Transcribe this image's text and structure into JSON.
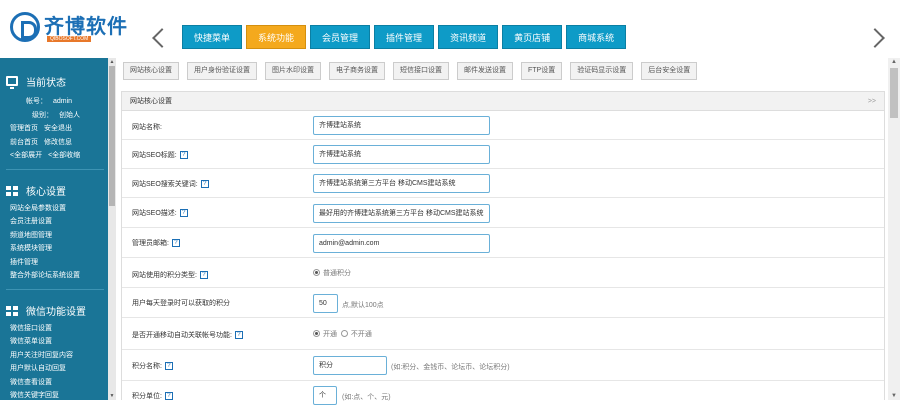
{
  "brand": {
    "name": "齐博软件",
    "tagline": "QIBOSOFT.COM"
  },
  "topnav": {
    "tabs": [
      {
        "label": "快捷菜单",
        "active": false
      },
      {
        "label": "系统功能",
        "active": true
      },
      {
        "label": "会员管理",
        "active": false
      },
      {
        "label": "插件管理",
        "active": false
      },
      {
        "label": "资讯频道",
        "active": false
      },
      {
        "label": "黄页店铺",
        "active": false
      },
      {
        "label": "商城系统",
        "active": false
      }
    ]
  },
  "sidebar": {
    "status": {
      "title": "当前状态",
      "rows": [
        {
          "k": "帐号：",
          "v": "admin"
        },
        {
          "k": "级别：",
          "v": "创始人"
        }
      ],
      "links": [
        {
          "a": "管理首页",
          "b": "安全退出"
        },
        {
          "a": "前台首页",
          "b": "修改信息"
        },
        {
          "a": "<全部展开",
          "b": "<全部收缩"
        }
      ]
    },
    "core": {
      "title": "核心设置",
      "items": [
        "网站全局参数设置",
        "会员注册设置",
        "频道地图管理",
        "系统模块管理",
        "插件管理",
        "整合外部论坛系统设置"
      ]
    },
    "wechat": {
      "title": "微信功能设置",
      "items": [
        "微信接口设置",
        "微信菜单设置",
        "用户关注时回复内容",
        "用户默认自动回复",
        "微信查看设置",
        "微信关键字回复"
      ]
    }
  },
  "subtabs": [
    "网站核心设置",
    "用户身份验证设置",
    "图片水印设置",
    "电子商务设置",
    "短信接口设置",
    "邮件发送设置",
    "FTP设置",
    "验证码显示设置",
    "后台安全设置"
  ],
  "panel": {
    "title": "网站核心设置",
    "more": ">>",
    "fields": {
      "site_name": {
        "label": "网站名称:",
        "value": "齐博建站系统"
      },
      "seo_title": {
        "label": "网站SEO标题:",
        "value": "齐博建站系统"
      },
      "seo_keywords": {
        "label": "网站SEO搜索关键词:",
        "value": "齐博建站系统第三方平台 移动CMS建站系统"
      },
      "seo_desc": {
        "label": "网站SEO描述:",
        "value": "最好用的齐博建站系统第三方平台 移动CMS建站系统"
      },
      "admin_email": {
        "label": "管理员邮箱:",
        "value": "admin@admin.com"
      },
      "site_integral": {
        "label": "网站使用的积分类型:",
        "option": "普通积分"
      },
      "signin_points": {
        "label": "用户每天登录时可以获取的积分",
        "value": "50",
        "suffix": "点,默认100点"
      },
      "auto_member": {
        "label": "是否开通移动自动关联帐号功能:",
        "on": "开通",
        "off": "不开通"
      },
      "points_name": {
        "label": "积分名称:",
        "value": "积分",
        "hint": "(如:积分、金钱币、论坛币、论坛积分)"
      },
      "points_unit": {
        "label": "积分单位:",
        "value": "个",
        "hint": "(如:点、个、元)"
      }
    }
  }
}
